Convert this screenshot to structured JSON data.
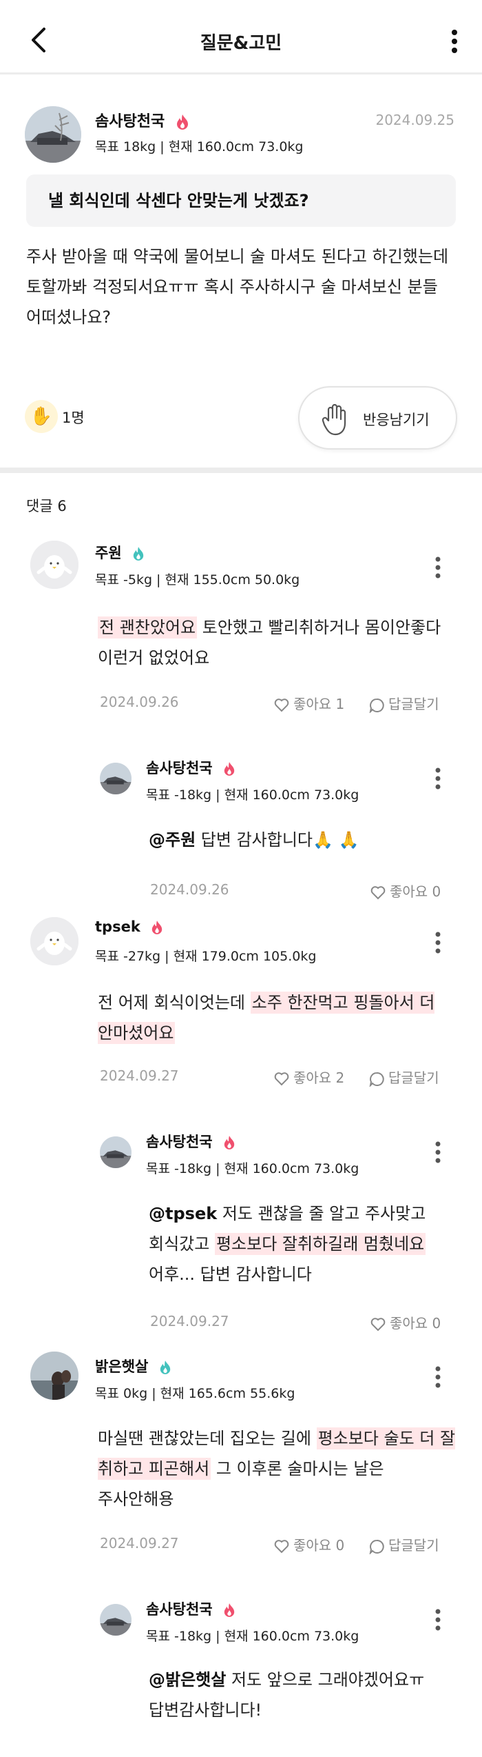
{
  "header": {
    "title": "질문&고민"
  },
  "post": {
    "author": "솜사탕천국",
    "date": "2024.09.25",
    "stats": "목표 18kg | 현재 160.0cm  73.0kg",
    "title": "낼 회식인데 삭센다 안맞는게 낫겠죠?",
    "body": "주사 받아올 때 약국에 물어보니 술 마셔도 된다고 하긴했는데 토할까봐 걱정되서요ㅠㅠ 혹시 주사하시구 술 마셔보신 분들 어떠셨나요?",
    "reaction_emoji": "✋",
    "reaction_count": "1명",
    "react_button_label": "반응남기기"
  },
  "comments_header": "댓글 6",
  "comments": [
    {
      "author": "주원",
      "stats": "목표 -5kg | 현재 155.0cm  50.0kg",
      "body_hl": "전 괜찬았어요",
      "body_rest": " 토안했고 빨리취하거나 몸이안좋다 이런거 없었어요",
      "date": "2024.09.26",
      "like": "좋아요 1",
      "reply": "답글달기"
    },
    {
      "author": "솜사탕천국",
      "stats": "목표 -18kg | 현재 160.0cm  73.0kg",
      "mention": "@주원",
      "body_rest": "  답변 감사합니다🙏 🙏",
      "date": "2024.09.26",
      "like": "좋아요 0"
    },
    {
      "author": "tpsek",
      "stats": "목표 -27kg | 현재 179.0cm  105.0kg",
      "body_pre": "전 어제 회식이엇는데 ",
      "body_hl": "소주 한잔먹고 핑돌아서 더 안마셨어요",
      "date": "2024.09.27",
      "like": "좋아요 2",
      "reply": "답글달기"
    },
    {
      "author": "솜사탕천국",
      "stats": "목표 -18kg | 현재 160.0cm  73.0kg",
      "mention": "@tpsek",
      "body_pre": "  저도 괜찮을 줄 알고 주사맞고 회식갔고 ",
      "body_hl": "평소보다 잘취하길래 멈췄네요",
      "body_post": " 어후... 답변 감사합니다",
      "date": "2024.09.27",
      "like": "좋아요 0"
    },
    {
      "author": "밝은햇살",
      "stats": "목표 0kg | 현재 165.6cm  55.6kg",
      "body_pre": "마실땐 괜찮았는데 집오는 길에 ",
      "body_hl": "평소보다 술도 더 잘 취하고 피곤해서",
      "body_post": " 그 이후론 술마시는 날은 주사안해용",
      "date": "2024.09.27",
      "like": "좋아요 0",
      "reply": "답글달기"
    },
    {
      "author": "솜사탕천국",
      "stats": "목표 -18kg | 현재 160.0cm  73.0kg",
      "mention": "@밝은햇살",
      "body_pre": "  저도 앞으로 그래야겠어요ㅠ 답변감사합니다!"
    }
  ],
  "colors": {
    "flame_red": "#f0506e",
    "flame_teal": "#43c2bd",
    "highlight": "#ffe6e8",
    "divider": "#ececec"
  },
  "icons": [
    "back-arrow-icon",
    "more-vertical-icon",
    "flame-icon",
    "hand-icon",
    "heart-icon",
    "speech-bubble-icon",
    "praying-hands-icon"
  ]
}
